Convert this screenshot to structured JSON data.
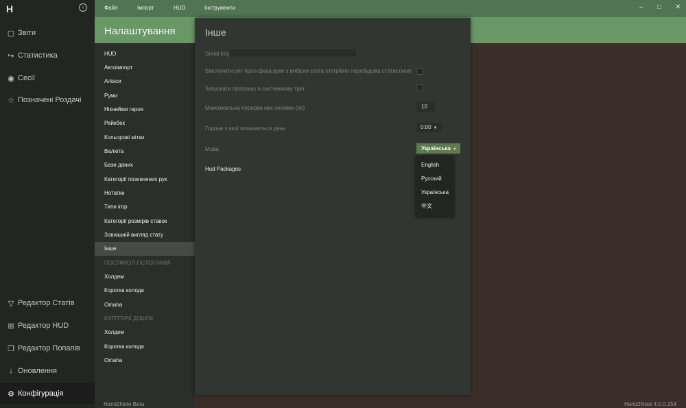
{
  "app": {
    "logo": "H",
    "status_left": "Hand2Note Beta",
    "version": "Hand2Note 4.0.0.154"
  },
  "rail": {
    "top_items": [
      {
        "label": "Звіти",
        "icon": "reports-icon"
      },
      {
        "label": "Статистика",
        "icon": "statistics-icon"
      },
      {
        "label": "Сесії",
        "icon": "sessions-icon"
      },
      {
        "label": "Позначені Роздачі",
        "icon": "star-icon"
      }
    ],
    "bottom_items": [
      {
        "label": "Редактор Статів",
        "icon": "filter-icon"
      },
      {
        "label": "Редактор HUD",
        "icon": "hud-icon"
      },
      {
        "label": "Редактор Попапів",
        "icon": "popup-icon"
      },
      {
        "label": "Оновлення",
        "icon": "download-icon"
      },
      {
        "label": "Конфігурація",
        "icon": "gear-icon"
      }
    ]
  },
  "menu": [
    "Файл",
    "Імпорт",
    "HUD",
    "Інструменти"
  ],
  "settings_title": "Налаштування",
  "nav": [
    {
      "label": "HUD"
    },
    {
      "label": "Автоімпорт"
    },
    {
      "label": "Аліаси"
    },
    {
      "label": "Руми"
    },
    {
      "label": "Нікнейми героя"
    },
    {
      "label": "Рейкбек"
    },
    {
      "label": "Кольорові мітки"
    },
    {
      "label": "Валюта"
    },
    {
      "label": "Бази даних"
    },
    {
      "label": "Категорії позначених рук"
    },
    {
      "label": "Нотатки"
    },
    {
      "label": "Типи ігор"
    },
    {
      "label": "Категорії розмірів ставок"
    },
    {
      "label": "Зовнішній вигляд стату"
    },
    {
      "label": "Інше"
    },
    {
      "label": "ПОСТФЛОП ГІСТОГРАМА"
    },
    {
      "label": "Холдем"
    },
    {
      "label": "Коротка колода"
    },
    {
      "label": "Omaha"
    },
    {
      "label": "КАТЕГОРІЇ ДОШОК"
    },
    {
      "label": "Холдем"
    },
    {
      "label": "Коротка колода"
    },
    {
      "label": "Omaha"
    }
  ],
  "panel": {
    "title": "Інше",
    "serial_label": "Serial key",
    "serial_value": "",
    "exclude_label": "Виключити рег-проп-фіша руки з вибірки стата (потрібна перебудова статистики)",
    "tray_label": "Запускати програму в системному треї",
    "gap_label": "Максимальна перерва між сесіями (хв)",
    "gap_value": "10",
    "hour_label": "Година з якої починається день",
    "hour_value": "0:00",
    "lang_label": "Мова",
    "lang_value": "Українська",
    "hud_packages": "Hud Packages",
    "lang_options": [
      "English",
      "Русский",
      "Українська",
      "中文"
    ]
  },
  "colors": {
    "accent": "#6a9766",
    "topbar": "#517452",
    "select": "#5f7a4d"
  }
}
